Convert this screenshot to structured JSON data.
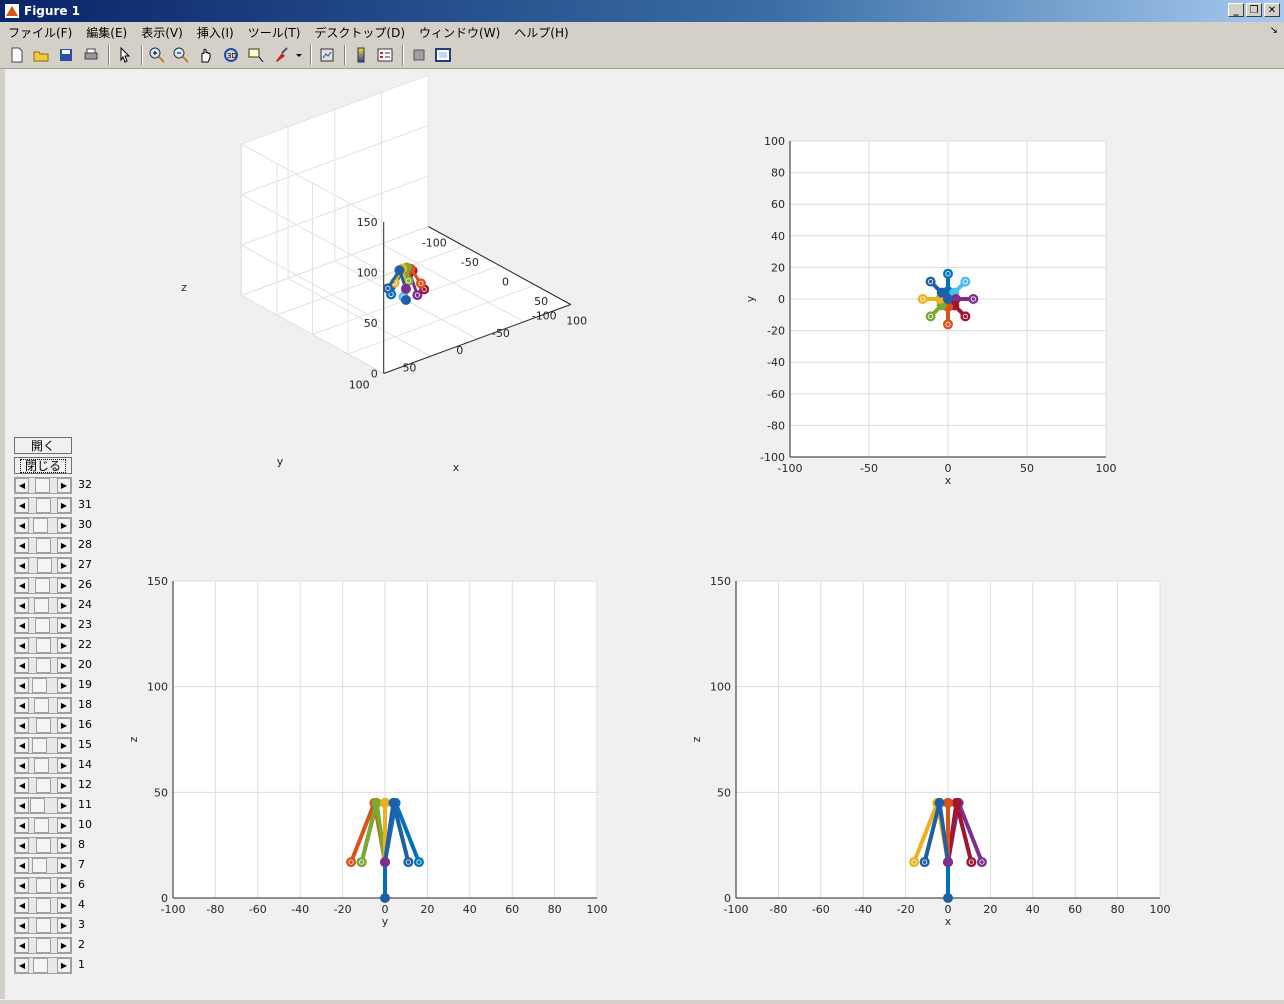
{
  "window": {
    "title": "Figure 1"
  },
  "menu": [
    "ファイル(F)",
    "編集(E)",
    "表示(V)",
    "挿入(I)",
    "ツール(T)",
    "デスクトップ(D)",
    "ウィンドウ(W)",
    "ヘルプ(H)"
  ],
  "toolbar_icons": [
    "new-figure-icon",
    "open-file-icon",
    "save-icon",
    "print-icon",
    "pointer-icon",
    "zoom-in-icon",
    "zoom-out-icon",
    "pan-icon",
    "rotate-3d-icon",
    "data-cursor-icon",
    "brush-icon",
    "brush-dropdown-icon",
    "link-plot-icon",
    "colorbar-icon",
    "legend-icon",
    "hide-plot-tools-icon",
    "show-plot-tools-icon"
  ],
  "controls": {
    "open_label": "開く",
    "close_label": "閉じる",
    "sliders": [
      {
        "label": "32",
        "value": 0.45
      },
      {
        "label": "31",
        "value": 0.55
      },
      {
        "label": "30",
        "value": 0.3
      },
      {
        "label": "28",
        "value": 0.55
      },
      {
        "label": "27",
        "value": 0.6
      },
      {
        "label": "26",
        "value": 0.45
      },
      {
        "label": "24",
        "value": 0.4
      },
      {
        "label": "23",
        "value": 0.45
      },
      {
        "label": "22",
        "value": 0.55
      },
      {
        "label": "20",
        "value": 0.5
      },
      {
        "label": "19",
        "value": 0.2
      },
      {
        "label": "18",
        "value": 0.4
      },
      {
        "label": "16",
        "value": 0.5
      },
      {
        "label": "15",
        "value": 0.2
      },
      {
        "label": "14",
        "value": 0.4
      },
      {
        "label": "12",
        "value": 0.55
      },
      {
        "label": "11",
        "value": 0.05
      },
      {
        "label": "10",
        "value": 0.35
      },
      {
        "label": "8",
        "value": 0.55
      },
      {
        "label": "7",
        "value": 0.2
      },
      {
        "label": "6",
        "value": 0.5
      },
      {
        "label": "4",
        "value": 0.55
      },
      {
        "label": "3",
        "value": 0.5
      },
      {
        "label": "2",
        "value": 0.5
      },
      {
        "label": "1",
        "value": 0.3
      }
    ]
  },
  "chart_data": [
    {
      "type": "line3d",
      "xlabel": "x",
      "ylabel": "y",
      "zlabel": "z",
      "xlim": [
        -100,
        100
      ],
      "ylim": [
        -100,
        100
      ],
      "zlim": [
        0,
        150
      ],
      "xticks": [
        "-100",
        "-50",
        "0",
        "50",
        "100"
      ],
      "yticks": [
        "-100",
        "-50",
        "0",
        "50",
        "100"
      ],
      "zticks": [
        "0",
        "50",
        "100",
        "150"
      ],
      "grid": true
    },
    {
      "type": "line",
      "view": "top",
      "xlabel": "x",
      "ylabel": "y",
      "xlim": [
        -100,
        100
      ],
      "ylim": [
        -100,
        100
      ],
      "xticks": [
        "-100",
        "-50",
        "0",
        "50",
        "100"
      ],
      "yticks": [
        "-100",
        "-80",
        "-60",
        "-40",
        "-20",
        "0",
        "20",
        "40",
        "60",
        "80",
        "100"
      ],
      "grid": true
    },
    {
      "type": "line",
      "view": "side-y",
      "xlabel": "y",
      "ylabel": "z",
      "xlim": [
        -100,
        100
      ],
      "ylim": [
        0,
        150
      ],
      "xticks": [
        "-100",
        "-80",
        "-60",
        "-40",
        "-20",
        "0",
        "20",
        "40",
        "60",
        "80",
        "100"
      ],
      "yticks": [
        "0",
        "50",
        "100",
        "150"
      ],
      "grid": true
    },
    {
      "type": "line",
      "view": "side-x",
      "xlabel": "x",
      "ylabel": "z",
      "xlim": [
        -100,
        100
      ],
      "ylim": [
        0,
        150
      ],
      "xticks": [
        "-100",
        "-80",
        "-60",
        "-40",
        "-20",
        "0",
        "20",
        "40",
        "60",
        "80",
        "100"
      ],
      "yticks": [
        "0",
        "50",
        "100",
        "150"
      ],
      "grid": true
    }
  ],
  "robot": {
    "base": [
      0,
      0,
      0
    ],
    "hub": [
      0,
      0,
      17
    ],
    "legs": [
      {
        "knee": [
          0,
          5,
          45
        ],
        "foot": [
          0,
          16,
          17
        ],
        "color": "#0072bd"
      },
      {
        "knee": [
          4,
          4,
          45
        ],
        "foot": [
          11,
          11,
          17
        ],
        "color": "#4dbeee"
      },
      {
        "knee": [
          5,
          0,
          45
        ],
        "foot": [
          16,
          0,
          17
        ],
        "color": "#7e2f8e"
      },
      {
        "knee": [
          4,
          -4,
          45
        ],
        "foot": [
          11,
          -11,
          17
        ],
        "color": "#a2142f"
      },
      {
        "knee": [
          0,
          -5,
          45
        ],
        "foot": [
          0,
          -16,
          17
        ],
        "color": "#d95319"
      },
      {
        "knee": [
          -4,
          -4,
          45
        ],
        "foot": [
          -11,
          -11,
          17
        ],
        "color": "#77ac30"
      },
      {
        "knee": [
          -5,
          0,
          45
        ],
        "foot": [
          -16,
          0,
          17
        ],
        "color": "#edb120"
      },
      {
        "knee": [
          -4,
          4,
          45
        ],
        "foot": [
          -11,
          11,
          17
        ],
        "color": "#1f5fa8"
      }
    ]
  }
}
